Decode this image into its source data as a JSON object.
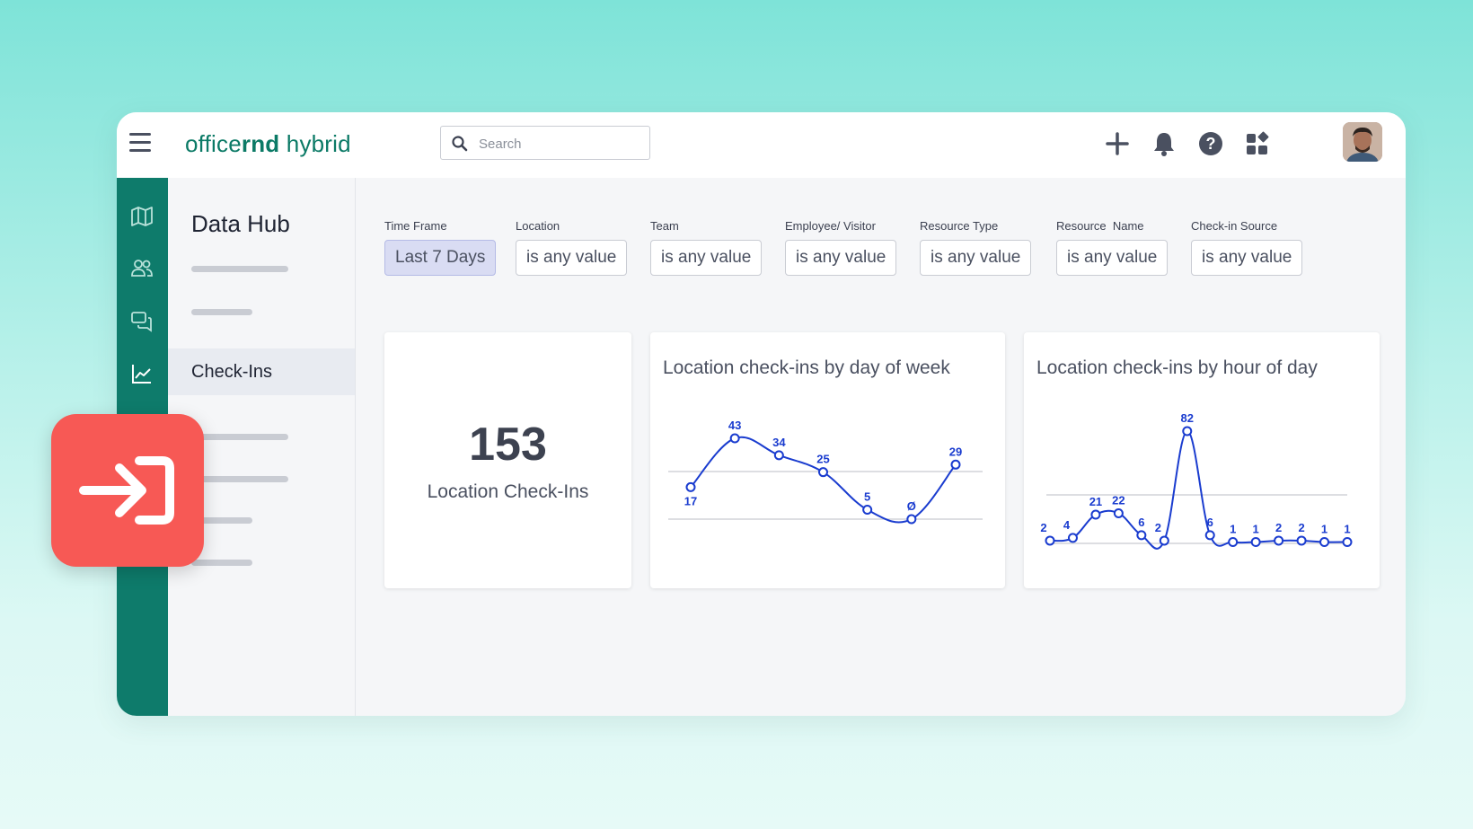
{
  "app": {
    "logo_regular_1": "office",
    "logo_bold": "rnd",
    "logo_regular_2": " hybrid"
  },
  "search": {
    "placeholder": "Search"
  },
  "topbar_icons": [
    "plus-icon",
    "bell-icon",
    "help-icon",
    "apps-icon"
  ],
  "sidebar_icons": [
    "map-icon",
    "people-icon",
    "chat-icon",
    "chart-icon"
  ],
  "subnav": {
    "title": "Data Hub",
    "active_item": "Check-Ins"
  },
  "filters": [
    {
      "label": "Time Frame",
      "value": "Last 7 Days"
    },
    {
      "label": "Location",
      "value": "is any value"
    },
    {
      "label": "Team",
      "value": "is any value"
    },
    {
      "label": "Employee/ Visitor",
      "value": "is any value"
    },
    {
      "label": "Resource Type",
      "value": "is any value"
    },
    {
      "label": "Resource  Name",
      "value": "is any value"
    },
    {
      "label": "Check-in Source",
      "value": "is any value"
    }
  ],
  "kpi": {
    "value": "153",
    "label": "Location Check-Ins"
  },
  "colors": {
    "brand": "#0e7b6b",
    "accent_line": "#1a3ccf",
    "badge": "#f75955"
  },
  "chart_data": [
    {
      "type": "line",
      "title": "Location check-ins by day of week",
      "values": [
        17,
        43,
        34,
        25,
        5,
        0,
        29
      ],
      "labels": [
        "17",
        "43",
        "34",
        "25",
        "5",
        "Ø",
        "29"
      ]
    },
    {
      "type": "line",
      "title": "Location check-ins by hour of day",
      "values": [
        2,
        4,
        21,
        22,
        6,
        2,
        82,
        6,
        1,
        1,
        2,
        2,
        1,
        1
      ],
      "labels": [
        "2",
        "4",
        "21",
        "22",
        "6",
        "2",
        "82",
        "6",
        "1",
        "1",
        "2",
        "2",
        "1",
        "1"
      ]
    }
  ]
}
